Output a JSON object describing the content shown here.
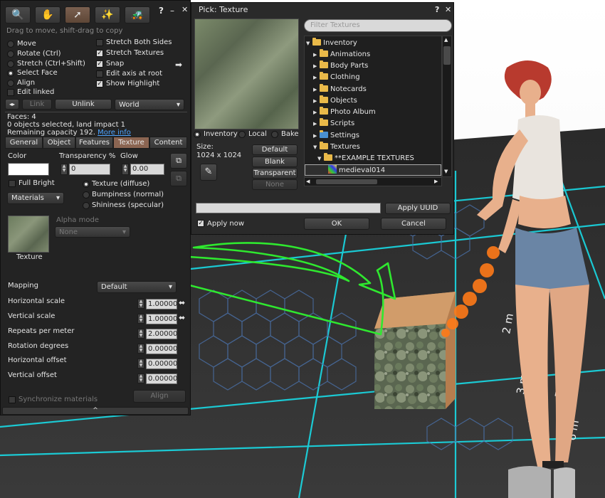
{
  "build_panel": {
    "tool_icons": [
      "focus-icon",
      "move-hand-icon",
      "edit-arrow-icon",
      "create-wand-icon",
      "land-bulldozer-icon"
    ],
    "help": "?",
    "minimize": "–",
    "close": "✕",
    "hint": "Drag to move, shift-drag to copy",
    "modes": [
      "Move",
      "Rotate (Ctrl)",
      "Stretch (Ctrl+Shift)",
      "Select Face",
      "Align"
    ],
    "selected_mode": "Select Face",
    "edit_linked": "Edit linked",
    "options": [
      {
        "label": "Stretch Both Sides",
        "checked": false
      },
      {
        "label": "Stretch Textures",
        "checked": true
      },
      {
        "label": "Snap",
        "checked": true
      },
      {
        "label": "Edit axis at root",
        "checked": false
      },
      {
        "label": "Show Highlight",
        "checked": true
      }
    ],
    "link_label": "Link",
    "unlink_label": "Unlink",
    "ruler_value": "World",
    "faces": "Faces: 4",
    "selection_info": "0 objects selected, land impact 1",
    "remaining": "Remaining capacity 192.",
    "more_info": "More info",
    "tabs": [
      "General",
      "Object",
      "Features",
      "Texture",
      "Content"
    ],
    "active_tab": "Texture",
    "color_label": "Color",
    "transparency_label": "Transparency %",
    "transparency_value": "0",
    "glow_label": "Glow",
    "glow_value": "0.00",
    "full_bright": "Full Bright",
    "materials_combo": "Materials",
    "material_types": [
      "Texture (diffuse)",
      "Bumpiness (normal)",
      "Shininess (specular)"
    ],
    "alpha_mode_label": "Alpha mode",
    "alpha_mode_value": "None",
    "texture_caption": "Texture",
    "mapping_label": "Mapping",
    "mapping_value": "Default",
    "params": [
      {
        "label": "Horizontal scale",
        "value": "1.00000"
      },
      {
        "label": "Vertical scale",
        "value": "1.00000"
      },
      {
        "label": "Repeats per meter",
        "value": "2.00000"
      },
      {
        "label": "Rotation degrees",
        "value": "0.00000"
      },
      {
        "label": "Horizontal offset",
        "value": "0.00000"
      },
      {
        "label": "Vertical offset",
        "value": "0.00000"
      }
    ],
    "sync_materials": "Synchronize materials",
    "align_label": "Align",
    "collapse": "^"
  },
  "picker": {
    "title": "Pick: Texture",
    "help": "?",
    "close": "✕",
    "filter_placeholder": "Filter Textures",
    "tree": [
      {
        "label": "Inventory",
        "depth": 0,
        "arrow": "▼",
        "icon": "folder-open-icon"
      },
      {
        "label": "Animations",
        "depth": 1,
        "arrow": "▶",
        "icon": "animation-folder-icon"
      },
      {
        "label": "Body Parts",
        "depth": 1,
        "arrow": "▶",
        "icon": "bodypart-folder-icon"
      },
      {
        "label": "Clothing",
        "depth": 1,
        "arrow": "▶",
        "icon": "clothing-folder-icon"
      },
      {
        "label": "Notecards",
        "depth": 1,
        "arrow": "▶",
        "icon": "notecard-folder-icon"
      },
      {
        "label": "Objects",
        "depth": 1,
        "arrow": "▶",
        "icon": "objects-folder-icon"
      },
      {
        "label": "Photo Album",
        "depth": 1,
        "arrow": "▶",
        "icon": "photo-folder-icon"
      },
      {
        "label": "Scripts",
        "depth": 1,
        "arrow": "▶",
        "icon": "scripts-folder-icon"
      },
      {
        "label": "Settings",
        "depth": 1,
        "arrow": "▶",
        "icon": "settings-folder-icon"
      },
      {
        "label": "Textures",
        "depth": 1,
        "arrow": "▼",
        "icon": "texture-folder-icon"
      },
      {
        "label": "**EXAMPLE TEXTURES",
        "depth": 2,
        "arrow": "▼",
        "icon": "folder-open-icon"
      },
      {
        "label": "medieval014",
        "depth": 3,
        "arrow": "",
        "icon": "texture-item-icon"
      }
    ],
    "sources": [
      "Inventory",
      "Local",
      "Bake"
    ],
    "selected_source": "Inventory",
    "size_label": "Size:",
    "size_value": "1024 x 1024",
    "default_label": "Default",
    "blank_label": "Blank",
    "transparent_label": "Transparent",
    "none_label": "None",
    "uuid_value": "",
    "apply_uuid": "Apply UUID",
    "apply_now": "Apply now",
    "ok_label": "OK",
    "cancel_label": "Cancel"
  },
  "scene_marks": [
    "2 m",
    "3 m",
    "4 m",
    "5 m",
    "6 m"
  ],
  "colors": {
    "panel": "#232323",
    "accent_tab": "#8b6552",
    "arrow": "#2fe82f",
    "link": "#4ea4ff"
  }
}
